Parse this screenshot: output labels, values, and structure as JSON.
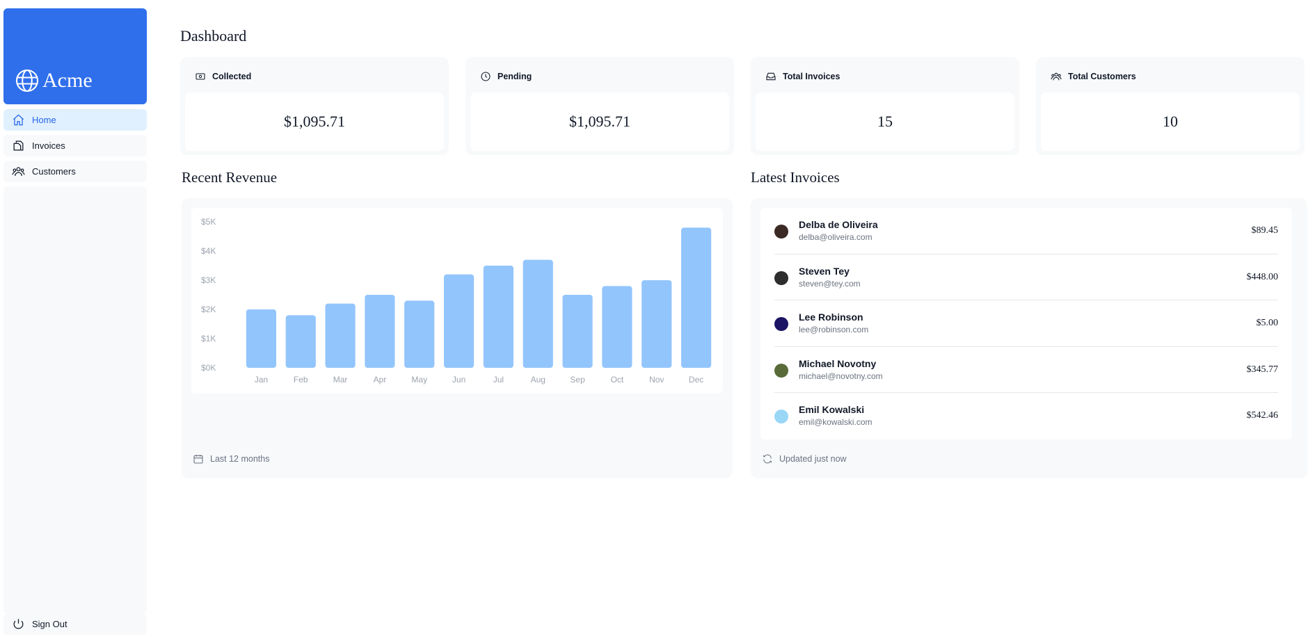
{
  "sidebar": {
    "brand": "Acme",
    "items": [
      {
        "label": "Home",
        "icon": "home-icon",
        "active": true
      },
      {
        "label": "Invoices",
        "icon": "documents-icon",
        "active": false
      },
      {
        "label": "Customers",
        "icon": "users-icon",
        "active": false
      }
    ],
    "sign_out": "Sign Out"
  },
  "main": {
    "title": "Dashboard",
    "cards": [
      {
        "title": "Collected",
        "value": "$1,095.71",
        "icon": "banknotes-icon"
      },
      {
        "title": "Pending",
        "value": "$1,095.71",
        "icon": "clock-icon"
      },
      {
        "title": "Total Invoices",
        "value": "15",
        "icon": "inbox-icon"
      },
      {
        "title": "Total Customers",
        "value": "10",
        "icon": "user-group-icon"
      }
    ],
    "revenue": {
      "title": "Recent Revenue",
      "footer": "Last 12 months"
    },
    "latest": {
      "title": "Latest Invoices",
      "footer": "Updated just now",
      "rows": [
        {
          "name": "Delba de Oliveira",
          "email": "delba@oliveira.com",
          "amount": "$89.45",
          "avatar_color": "#3b2a24"
        },
        {
          "name": "Steven Tey",
          "email": "steven@tey.com",
          "amount": "$448.00",
          "avatar_color": "#2d2d2d"
        },
        {
          "name": "Lee Robinson",
          "email": "lee@robinson.com",
          "amount": "$5.00",
          "avatar_color": "#1b1464"
        },
        {
          "name": "Michael Novotny",
          "email": "michael@novotny.com",
          "amount": "$345.77",
          "avatar_color": "#5a6b3a"
        },
        {
          "name": "Emil Kowalski",
          "email": "emil@kowalski.com",
          "amount": "$542.46",
          "avatar_color": "#9ad6f5"
        }
      ]
    }
  },
  "chart_data": {
    "type": "bar",
    "title": "",
    "xlabel": "",
    "ylabel": "",
    "categories": [
      "Jan",
      "Feb",
      "Mar",
      "Apr",
      "May",
      "Jun",
      "Jul",
      "Aug",
      "Sep",
      "Oct",
      "Nov",
      "Dec"
    ],
    "values": [
      2000,
      1800,
      2200,
      2500,
      2300,
      3200,
      3500,
      3700,
      2500,
      2800,
      3000,
      4800
    ],
    "y_ticks": [
      "$0K",
      "$1K",
      "$2K",
      "$3K",
      "$4K",
      "$5K"
    ],
    "ylim": [
      0,
      5000
    ],
    "grid": false,
    "bar_color": "#93c5fd"
  }
}
